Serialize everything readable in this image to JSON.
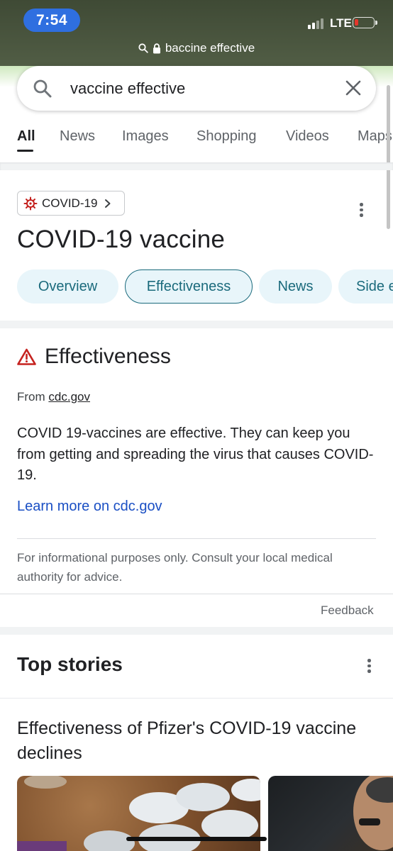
{
  "status_bar": {
    "time": "7:54",
    "network": "LTE",
    "battery_level": 0.15,
    "battery_color": "#e5372c",
    "time_pill_color": "#2f6fe0"
  },
  "url_bar": {
    "url_text": "baccine effective",
    "search_icon": "search-icon",
    "lock_icon": "lock-icon"
  },
  "search": {
    "query": "vaccine effective",
    "search_icon": "search-icon",
    "clear_icon": "close-icon"
  },
  "tabs": [
    {
      "label": "All",
      "active": true
    },
    {
      "label": "News",
      "active": false
    },
    {
      "label": "Images",
      "active": false
    },
    {
      "label": "Shopping",
      "active": false
    },
    {
      "label": "Videos",
      "active": false
    },
    {
      "label": "Maps",
      "active": false
    }
  ],
  "knowledge_card": {
    "chip_label": "COVID-19",
    "chip_icon": "virus-icon",
    "title": "COVID-19 vaccine",
    "pills": [
      {
        "label": "Overview",
        "active": false
      },
      {
        "label": "Effectiveness",
        "active": true
      },
      {
        "label": "News",
        "active": false
      },
      {
        "label": "Side effects",
        "active": false
      }
    ],
    "accent_color": "#1a6a7c",
    "pill_bg": "#e8f5fa"
  },
  "effectiveness": {
    "title": "Effectiveness",
    "icon": "warning-icon",
    "icon_color": "#c5221f",
    "from_label": "From",
    "source": "cdc.gov",
    "body": "COVID 19-vaccines are effective. They can keep you from getting and spreading the virus that causes COVID-19.",
    "learn_more": "Learn more on cdc.gov",
    "link_color": "#1a4fc4",
    "disclaimer": "For informational purposes only. Consult your local medical authority for advice.",
    "feedback": "Feedback"
  },
  "top_stories": {
    "title": "Top stories",
    "story_title": "Effectiveness of Pfizer's COVID-19 vaccine declines"
  }
}
